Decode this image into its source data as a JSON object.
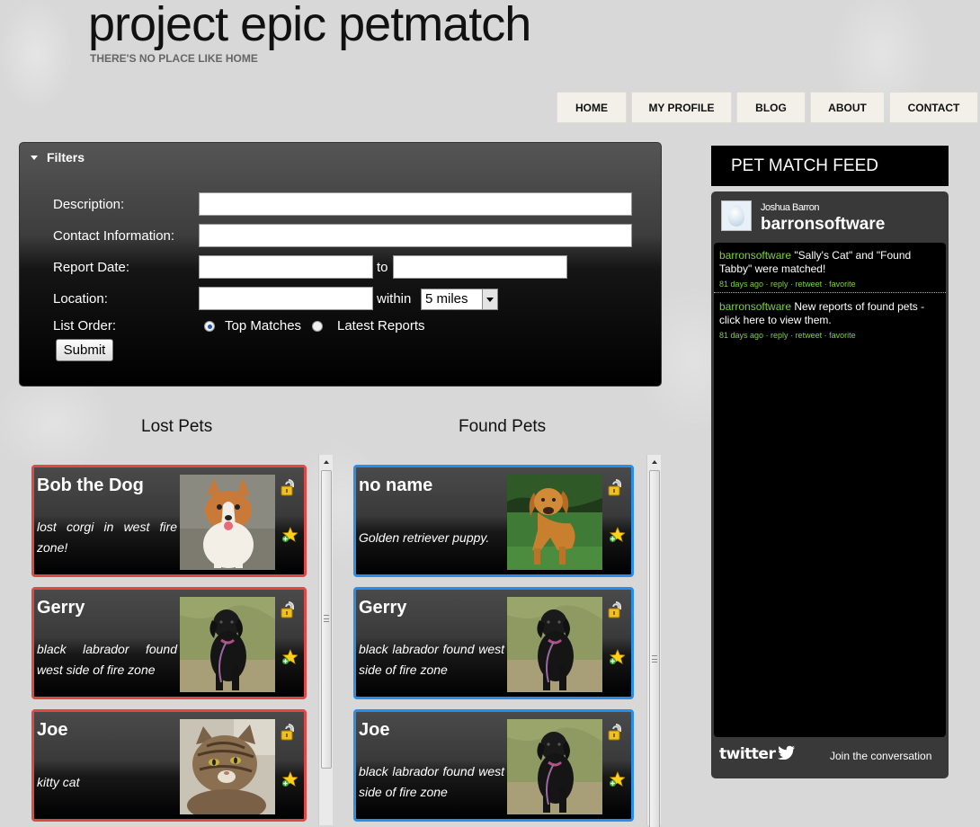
{
  "site": {
    "title": "project epic petmatch",
    "tagline": "THERE'S NO PLACE LIKE HOME"
  },
  "nav": {
    "items": [
      {
        "label": "HOME"
      },
      {
        "label": "MY PROFILE"
      },
      {
        "label": "BLOG"
      },
      {
        "label": "ABOUT"
      },
      {
        "label": "CONTACT"
      }
    ]
  },
  "filters": {
    "title": "Filters",
    "description_label": "Description:",
    "description_value": "",
    "contact_label": "Contact Information:",
    "contact_value": "",
    "report_date_label": "Report Date:",
    "date_from_value": "",
    "date_to_label": "to",
    "date_to_value": "",
    "location_label": "Location:",
    "location_value": "",
    "within_label": "within",
    "distance_selected": "5 miles",
    "list_order_label": "List Order:",
    "order_options": [
      {
        "label": "Top Matches",
        "selected": true
      },
      {
        "label": "Latest Reports",
        "selected": false
      }
    ],
    "submit_label": "Submit"
  },
  "lost": {
    "title": "Lost Pets",
    "accent_color": "#e04848",
    "items": [
      {
        "name": "Bob the Dog",
        "description": "lost corgi in west fire zone!",
        "photo": "corgi-photo"
      },
      {
        "name": "Gerry",
        "description": "black labrador found west side of fire zone",
        "photo": "black-lab-photo"
      },
      {
        "name": "Joe",
        "description": "kitty cat",
        "photo": "tabby-cat-photo"
      }
    ]
  },
  "found": {
    "title": "Found Pets",
    "accent_color": "#2a8de8",
    "items": [
      {
        "name": "no name",
        "description": "Golden retriever puppy.",
        "photo": "golden-retriever-photo"
      },
      {
        "name": "Gerry",
        "description": "black labrador found west side of fire zone",
        "photo": "black-lab-photo"
      },
      {
        "name": "Joe",
        "description": "black labrador found west side of fire zone",
        "photo": "black-lab-photo"
      }
    ]
  },
  "feed": {
    "title": "PET MATCH FEED",
    "real_name": "Joshua Barron",
    "handle": "barronsoftware",
    "tweets": [
      {
        "user": "barronsoftware",
        "text": "\"Sally's Cat\" and \"Found Tabby\" were matched!",
        "time": "81 days ago",
        "actions": [
          "reply",
          "retweet",
          "favorite"
        ]
      },
      {
        "user": "barronsoftware",
        "text": "New reports of found pets - click here to view them.",
        "time": "81 days ago",
        "actions": [
          "reply",
          "retweet",
          "favorite"
        ]
      }
    ],
    "brand": "twitter",
    "join_label": "Join the conversation",
    "link_color": "#7dd23a"
  }
}
